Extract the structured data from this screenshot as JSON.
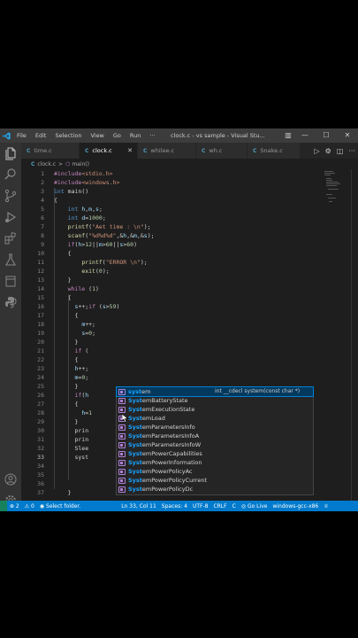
{
  "titlebar": {
    "menu": [
      "File",
      "Edit",
      "Selection",
      "View",
      "Go",
      "Run",
      "···"
    ],
    "window_title": "clock.c - vs sample - Visual Stu...",
    "controls": [
      "—",
      "☐",
      "✕"
    ],
    "layout_btn": "▥"
  },
  "tabs": [
    {
      "icon": "C",
      "label": "time.c"
    },
    {
      "icon": "C",
      "label": "clock.c",
      "close": "✕"
    },
    {
      "icon": "C",
      "label": "whilee.c"
    },
    {
      "icon": "C",
      "label": "wh.c"
    },
    {
      "icon": "C",
      "label": "Snake.c"
    }
  ],
  "tab_actions": [
    "▷",
    "⚙",
    "◫",
    "···"
  ],
  "breadcrumb": {
    "file": "clock.c",
    "sep": ">",
    "symbol_icon": "⬡",
    "symbol": "main()"
  },
  "lines": [
    {
      "n": "1",
      "t": "#include<stdio.h>"
    },
    {
      "n": "2",
      "t": "#include<windows.h>"
    },
    {
      "n": "3",
      "t": "int main()"
    },
    {
      "n": "4",
      "t": "{"
    },
    {
      "n": "5",
      "t": "    int h,m,s;"
    },
    {
      "n": "6",
      "t": "    int d=1000;"
    },
    {
      "n": "7",
      "t": "    printf(\"Aet time : \\n\");"
    },
    {
      "n": "8",
      "t": "    scanf(\"%d%d%d\",&h,&m,&s);"
    },
    {
      "n": "9",
      "t": "    if(h>12||m>60||s>60)"
    },
    {
      "n": "10",
      "t": "    {"
    },
    {
      "n": "11",
      "t": "        printf(\"ERROR \\n\");"
    },
    {
      "n": "12",
      "t": "        exit(0);"
    },
    {
      "n": "13",
      "t": "    }"
    },
    {
      "n": "14",
      "t": "    while (1)"
    },
    {
      "n": "15",
      "t": "    {"
    },
    {
      "n": "16",
      "t": "      s++;if (s>59)"
    },
    {
      "n": "17",
      "t": "      {"
    },
    {
      "n": "18",
      "t": "        m++;"
    },
    {
      "n": "19",
      "t": "        s=0;"
    },
    {
      "n": "20",
      "t": "      }"
    },
    {
      "n": "21",
      "t": "      if ("
    },
    {
      "n": "22",
      "t": "      {"
    },
    {
      "n": "23",
      "t": "      h++;"
    },
    {
      "n": "24",
      "t": "      m=0;"
    },
    {
      "n": "25",
      "t": "      }"
    },
    {
      "n": "26",
      "t": "      if(h"
    },
    {
      "n": "27",
      "t": "      {"
    },
    {
      "n": "28",
      "t": "        h=1"
    },
    {
      "n": "29",
      "t": "      }"
    },
    {
      "n": "30",
      "t": "      prin"
    },
    {
      "n": "31",
      "t": "      prin"
    },
    {
      "n": "32",
      "t": "      Slee"
    },
    {
      "n": "33",
      "t": "      syst"
    },
    {
      "n": "34",
      "t": ""
    },
    {
      "n": "35",
      "t": ""
    },
    {
      "n": "36",
      "t": ""
    },
    {
      "n": "37",
      "t": "    }"
    }
  ],
  "suggestions": [
    {
      "match": "syst",
      "rest": "em",
      "detail": "int __cdecl system(const char *)"
    },
    {
      "match": "Syst",
      "rest": "emBatteryState"
    },
    {
      "match": "Syst",
      "rest": "emExecutionState"
    },
    {
      "match": "Syst",
      "rest": "emLoad"
    },
    {
      "match": "Syst",
      "rest": "emParametersInfo"
    },
    {
      "match": "Syst",
      "rest": "emParametersInfoA"
    },
    {
      "match": "Syst",
      "rest": "emParametersInfoW"
    },
    {
      "match": "Syst",
      "rest": "emPowerCapabilities"
    },
    {
      "match": "Syst",
      "rest": "emPowerInformation"
    },
    {
      "match": "Syst",
      "rest": "emPowerPolicyAc"
    },
    {
      "match": "Syst",
      "rest": "emPowerPolicyCurrent"
    },
    {
      "match": "Syst",
      "rest": "emPowerPolicyDc"
    }
  ],
  "status": {
    "errors": "⊗ 2",
    "warnings": "⚠ 0",
    "folder": "◉ Select folder.",
    "position": "Ln 33, Col 11",
    "spaces": "Spaces: 4",
    "encoding": "UTF-8",
    "eol": "CRLF",
    "language": "C",
    "golive": "◎ Go Live",
    "config": "windows-gcc-x86",
    "bell": "♕"
  },
  "colors": {
    "accent": "#007acc",
    "editor_bg": "#1e1e1e",
    "suggest_match": "#18a3ff"
  }
}
